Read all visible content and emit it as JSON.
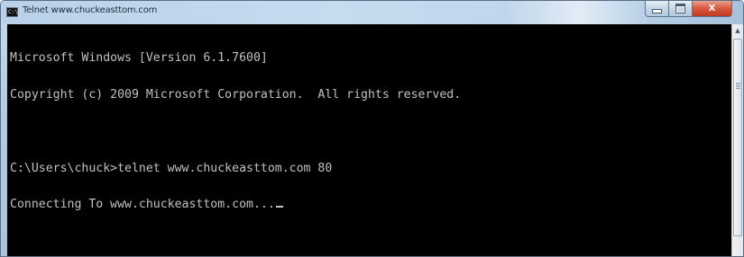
{
  "window": {
    "title": "Telnet www.chuckeasttom.com",
    "icon": "console-icon",
    "icon_glyph": "C:\\"
  },
  "caption_buttons": {
    "minimize_icon": "minimize-icon",
    "maximize_icon": "maximize-icon",
    "close_icon": "close-icon",
    "close_glyph": "X"
  },
  "console": {
    "lines": [
      "Microsoft Windows [Version 6.1.7600]",
      "Copyright (c) 2009 Microsoft Corporation.  All rights reserved.",
      "",
      "C:\\Users\\chuck>telnet www.chuckeasttom.com 80",
      "Connecting To www.chuckeasttom.com..."
    ]
  },
  "scrollbar": {
    "up_arrow_icon": "scroll-up-arrow-icon",
    "up_glyph": "▲"
  }
}
